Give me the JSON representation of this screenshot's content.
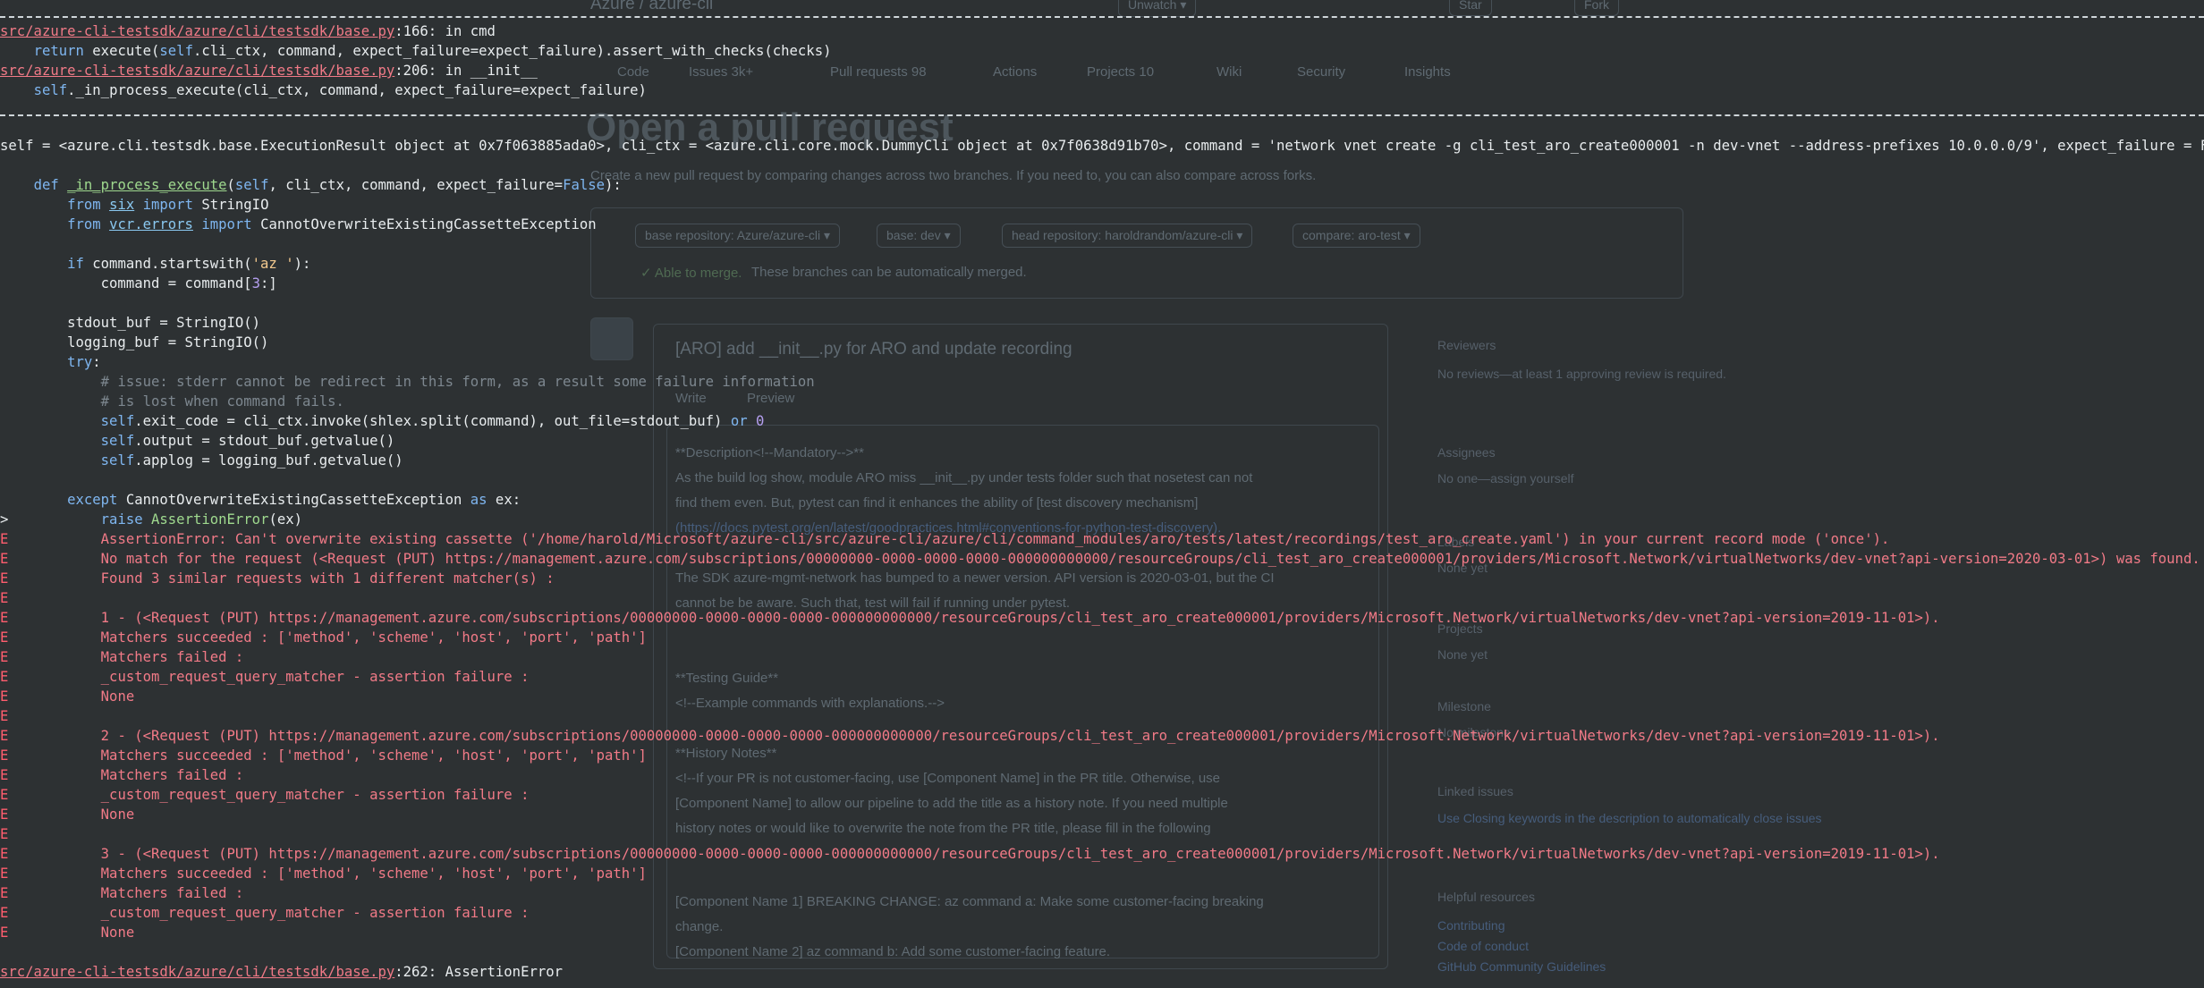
{
  "background": {
    "repo_title": "Azure / azure-cli",
    "header_actions": [
      "Unwatch ▾",
      "Star",
      "Fork"
    ],
    "nav_tabs": [
      "Code",
      "Issues 3k+",
      "Pull requests 98",
      "Actions",
      "Projects 10",
      "Wiki",
      "Security",
      "Insights"
    ],
    "page_title": "Open a pull request",
    "subtitle": "Create a new pull request by comparing changes across two branches. If you need to, you can also compare across forks.",
    "base_repo": "base repository: Azure/azure-cli ▾",
    "base": "base: dev ▾",
    "head_repo": "head repository: haroldrandom/azure-cli ▾",
    "compare": "compare: aro-test ▾",
    "able_to_merge": "✓ Able to merge.",
    "able_to_merge_rest": "These branches can be automatically merged.",
    "pr_title": "[ARO] add __init__.py for ARO and update recording",
    "write_tab": "Write",
    "preview_tab": "Preview",
    "body_lines": [
      "**Description<!--Mandatory-->**",
      "As the build log show, module ARO miss __init__.py under tests folder such that nosetest can not",
      "find them even. But, pytest can find it enhances the ability of [test discovery mechanism]",
      "(https://docs.pytest.org/en/latest/goodpractices.html#conventions-for-python-test-discovery).",
      "The SDK azure-mgmt-network has bumped to a newer version. API version is 2020-03-01, but the CI",
      "cannot be be aware. Such that, test will fail if running under pytest.",
      "**Testing Guide**",
      "<!--Example commands with explanations.-->",
      "**History Notes**",
      "<!--If your PR is not customer-facing, use [Component Name] in the PR title. Otherwise, use",
      "[Component Name] to allow our pipeline to add the title as a history note. If you need multiple",
      "history notes or would like to overwrite the note from the PR title, please fill in the following",
      "[Component Name 1] BREAKING CHANGE: az command a: Make some customer-facing breaking",
      "change.",
      "[Component Name 2] az command b: Add some customer-facing feature."
    ],
    "sidebar": {
      "reviewers": "Reviewers",
      "reviewers_text": "No reviews—at least 1 approving review is required.",
      "assignees": "Assignees",
      "assignees_text": "No one—assign yourself",
      "labels": "Labels",
      "labels_text": "None yet",
      "projects": "Projects",
      "projects_text": "None yet",
      "milestone": "Milestone",
      "milestone_text": "No milestone",
      "linked_issues": "Linked issues",
      "linked_issues_text": "Use Closing keywords in the description to automatically close issues",
      "helpful": "Helpful resources",
      "helpful_links": [
        "Contributing",
        "Code of conduct",
        "GitHub Community Guidelines"
      ]
    }
  },
  "terminal": {
    "lines": [
      {
        "seg": [
          {
            "c": "path",
            "t": "src/azure-cli-testsdk/azure/cli/testsdk/base.py"
          },
          {
            "c": "",
            "t": ":166: in cmd"
          }
        ]
      },
      {
        "seg": [
          {
            "c": "",
            "t": "    "
          },
          {
            "c": "kw",
            "t": "return"
          },
          {
            "c": "",
            "t": " execute("
          },
          {
            "c": "kw",
            "t": "self"
          },
          {
            "c": "",
            "t": ".cli_ctx, command, expect_failure=expect_failure).assert_with_checks(checks)"
          }
        ]
      },
      {
        "seg": [
          {
            "c": "path",
            "t": "src/azure-cli-testsdk/azure/cli/testsdk/base.py"
          },
          {
            "c": "",
            "t": ":206: in __init__"
          }
        ]
      },
      {
        "seg": [
          {
            "c": "",
            "t": "    "
          },
          {
            "c": "kw",
            "t": "self"
          },
          {
            "c": "",
            "t": "._in_process_execute(cli_ctx, command, expect_failure=expect_failure)"
          }
        ]
      },
      {
        "seg": [
          {
            "c": "",
            "t": "self = <azure.cli.testsdk.base.ExecutionResult object at 0x7f063885ada0>, cli_ctx = <azure.cli.core.mock.DummyCli object at 0x7f0638d91b70>, command = 'network vnet create -g cli_test_aro_create000001 -n dev-vnet --address-prefixes 10.0.0.0/9', expect_failure = False"
          }
        ]
      },
      {
        "seg": [
          {
            "c": "",
            "t": "    "
          },
          {
            "c": "kw",
            "t": "def"
          },
          {
            "c": "",
            "t": " "
          },
          {
            "c": "fn",
            "t": "_in_process_execute"
          },
          {
            "c": "",
            "t": "("
          },
          {
            "c": "kw",
            "t": "self"
          },
          {
            "c": "",
            "t": ", cli_ctx, command, expect_failure="
          },
          {
            "c": "kw",
            "t": "False"
          },
          {
            "c": "",
            "t": "):"
          }
        ]
      },
      {
        "seg": [
          {
            "c": "",
            "t": "        "
          },
          {
            "c": "kw",
            "t": "from"
          },
          {
            "c": "",
            "t": " "
          },
          {
            "c": "mod",
            "t": "six"
          },
          {
            "c": "",
            "t": " "
          },
          {
            "c": "kw",
            "t": "import"
          },
          {
            "c": "",
            "t": " StringIO"
          }
        ]
      },
      {
        "seg": [
          {
            "c": "",
            "t": "        "
          },
          {
            "c": "kw",
            "t": "from"
          },
          {
            "c": "",
            "t": " "
          },
          {
            "c": "mod",
            "t": "vcr.errors"
          },
          {
            "c": "",
            "t": " "
          },
          {
            "c": "kw",
            "t": "import"
          },
          {
            "c": "",
            "t": " CannotOverwriteExistingCassetteException"
          }
        ]
      },
      {
        "seg": [
          {
            "c": "",
            "t": "        "
          },
          {
            "c": "kw",
            "t": "if"
          },
          {
            "c": "",
            "t": " command.startswith("
          },
          {
            "c": "str",
            "t": "'az '"
          },
          {
            "c": "",
            "t": "):"
          }
        ]
      },
      {
        "seg": [
          {
            "c": "",
            "t": "            command = command["
          },
          {
            "c": "num",
            "t": "3"
          },
          {
            "c": "",
            "t": ":]"
          }
        ]
      },
      {
        "seg": [
          {
            "c": "",
            "t": "        stdout_buf = StringIO()"
          }
        ]
      },
      {
        "seg": [
          {
            "c": "",
            "t": "        logging_buf = StringIO()"
          }
        ]
      },
      {
        "seg": [
          {
            "c": "",
            "t": "        "
          },
          {
            "c": "kw",
            "t": "try"
          },
          {
            "c": "",
            "t": ":"
          }
        ]
      },
      {
        "seg": [
          {
            "c": "",
            "t": "            "
          },
          {
            "c": "com",
            "t": "# issue: stderr cannot be redirect in this form, as a result some failure information"
          }
        ]
      },
      {
        "seg": [
          {
            "c": "",
            "t": "            "
          },
          {
            "c": "com",
            "t": "# is lost when command fails."
          }
        ]
      },
      {
        "seg": [
          {
            "c": "",
            "t": "            "
          },
          {
            "c": "kw",
            "t": "self"
          },
          {
            "c": "",
            "t": ".exit_code = cli_ctx.invoke(shlex.split(command), out_file=stdout_buf) "
          },
          {
            "c": "kw",
            "t": "or"
          },
          {
            "c": "",
            "t": " "
          },
          {
            "c": "num",
            "t": "0"
          }
        ]
      },
      {
        "seg": [
          {
            "c": "",
            "t": "            "
          },
          {
            "c": "kw",
            "t": "self"
          },
          {
            "c": "",
            "t": ".output = stdout_buf.getvalue()"
          }
        ]
      },
      {
        "seg": [
          {
            "c": "",
            "t": "            "
          },
          {
            "c": "kw",
            "t": "self"
          },
          {
            "c": "",
            "t": ".applog = logging_buf.getvalue()"
          }
        ]
      },
      {
        "seg": [
          {
            "c": "",
            "t": "        "
          },
          {
            "c": "kw",
            "t": "except"
          },
          {
            "c": "",
            "t": " CannotOverwriteExistingCassetteException "
          },
          {
            "c": "kw",
            "t": "as"
          },
          {
            "c": "",
            "t": " ex:"
          }
        ]
      },
      {
        "seg": [
          {
            "c": "arrow",
            "t": ">"
          },
          {
            "c": "",
            "t": "           "
          },
          {
            "c": "kw",
            "t": "raise"
          },
          {
            "c": "",
            "t": " "
          },
          {
            "c": "cls",
            "t": "AssertionError"
          },
          {
            "c": "",
            "t": "(ex)"
          }
        ]
      },
      {
        "seg": [
          {
            "c": "marker",
            "t": "E"
          },
          {
            "c": "red",
            "t": "           AssertionError: Can't overwrite existing cassette ('/home/harold/Microsoft/azure-cli/src/azure-cli/azure/cli/command_modules/aro/tests/latest/recordings/test_aro_create.yaml') in your current record mode ('once')."
          }
        ]
      },
      {
        "seg": [
          {
            "c": "marker",
            "t": "E"
          },
          {
            "c": "red",
            "t": "           No match for the request (<Request (PUT) https://management.azure.com/subscriptions/00000000-0000-0000-0000-000000000000/resourceGroups/cli_test_aro_create000001/providers/Microsoft.Network/virtualNetworks/dev-vnet?api-version=2020-03-01>) was found."
          }
        ]
      },
      {
        "seg": [
          {
            "c": "marker",
            "t": "E"
          },
          {
            "c": "red",
            "t": "           Found 3 similar requests with 1 different matcher(s) :"
          }
        ]
      },
      {
        "seg": [
          {
            "c": "marker",
            "t": "E"
          }
        ]
      },
      {
        "seg": [
          {
            "c": "marker",
            "t": "E"
          },
          {
            "c": "red",
            "t": "           1 - (<Request (PUT) https://management.azure.com/subscriptions/00000000-0000-0000-0000-000000000000/resourceGroups/cli_test_aro_create000001/providers/Microsoft.Network/virtualNetworks/dev-vnet?api-version=2019-11-01>)."
          }
        ]
      },
      {
        "seg": [
          {
            "c": "marker",
            "t": "E"
          },
          {
            "c": "red",
            "t": "           Matchers succeeded : ['method', 'scheme', 'host', 'port', 'path']"
          }
        ]
      },
      {
        "seg": [
          {
            "c": "marker",
            "t": "E"
          },
          {
            "c": "red",
            "t": "           Matchers failed :"
          }
        ]
      },
      {
        "seg": [
          {
            "c": "marker",
            "t": "E"
          },
          {
            "c": "red",
            "t": "           _custom_request_query_matcher - assertion failure :"
          }
        ]
      },
      {
        "seg": [
          {
            "c": "marker",
            "t": "E"
          },
          {
            "c": "red",
            "t": "           None"
          }
        ]
      },
      {
        "seg": [
          {
            "c": "marker",
            "t": "E"
          }
        ]
      },
      {
        "seg": [
          {
            "c": "marker",
            "t": "E"
          },
          {
            "c": "red",
            "t": "           2 - (<Request (PUT) https://management.azure.com/subscriptions/00000000-0000-0000-0000-000000000000/resourceGroups/cli_test_aro_create000001/providers/Microsoft.Network/virtualNetworks/dev-vnet?api-version=2019-11-01>)."
          }
        ]
      },
      {
        "seg": [
          {
            "c": "marker",
            "t": "E"
          },
          {
            "c": "red",
            "t": "           Matchers succeeded : ['method', 'scheme', 'host', 'port', 'path']"
          }
        ]
      },
      {
        "seg": [
          {
            "c": "marker",
            "t": "E"
          },
          {
            "c": "red",
            "t": "           Matchers failed :"
          }
        ]
      },
      {
        "seg": [
          {
            "c": "marker",
            "t": "E"
          },
          {
            "c": "red",
            "t": "           _custom_request_query_matcher - assertion failure :"
          }
        ]
      },
      {
        "seg": [
          {
            "c": "marker",
            "t": "E"
          },
          {
            "c": "red",
            "t": "           None"
          }
        ]
      },
      {
        "seg": [
          {
            "c": "marker",
            "t": "E"
          }
        ]
      },
      {
        "seg": [
          {
            "c": "marker",
            "t": "E"
          },
          {
            "c": "red",
            "t": "           3 - (<Request (PUT) https://management.azure.com/subscriptions/00000000-0000-0000-0000-000000000000/resourceGroups/cli_test_aro_create000001/providers/Microsoft.Network/virtualNetworks/dev-vnet?api-version=2019-11-01>)."
          }
        ]
      },
      {
        "seg": [
          {
            "c": "marker",
            "t": "E"
          },
          {
            "c": "red",
            "t": "           Matchers succeeded : ['method', 'scheme', 'host', 'port', 'path']"
          }
        ]
      },
      {
        "seg": [
          {
            "c": "marker",
            "t": "E"
          },
          {
            "c": "red",
            "t": "           Matchers failed :"
          }
        ]
      },
      {
        "seg": [
          {
            "c": "marker",
            "t": "E"
          },
          {
            "c": "red",
            "t": "           _custom_request_query_matcher - assertion failure :"
          }
        ]
      },
      {
        "seg": [
          {
            "c": "marker",
            "t": "E"
          },
          {
            "c": "red",
            "t": "           None"
          }
        ]
      },
      {
        "seg": [
          {
            "c": "path",
            "t": "src/azure-cli-testsdk/azure/cli/testsdk/base.py"
          },
          {
            "c": "",
            "t": ":262: AssertionError"
          }
        ]
      }
    ]
  }
}
